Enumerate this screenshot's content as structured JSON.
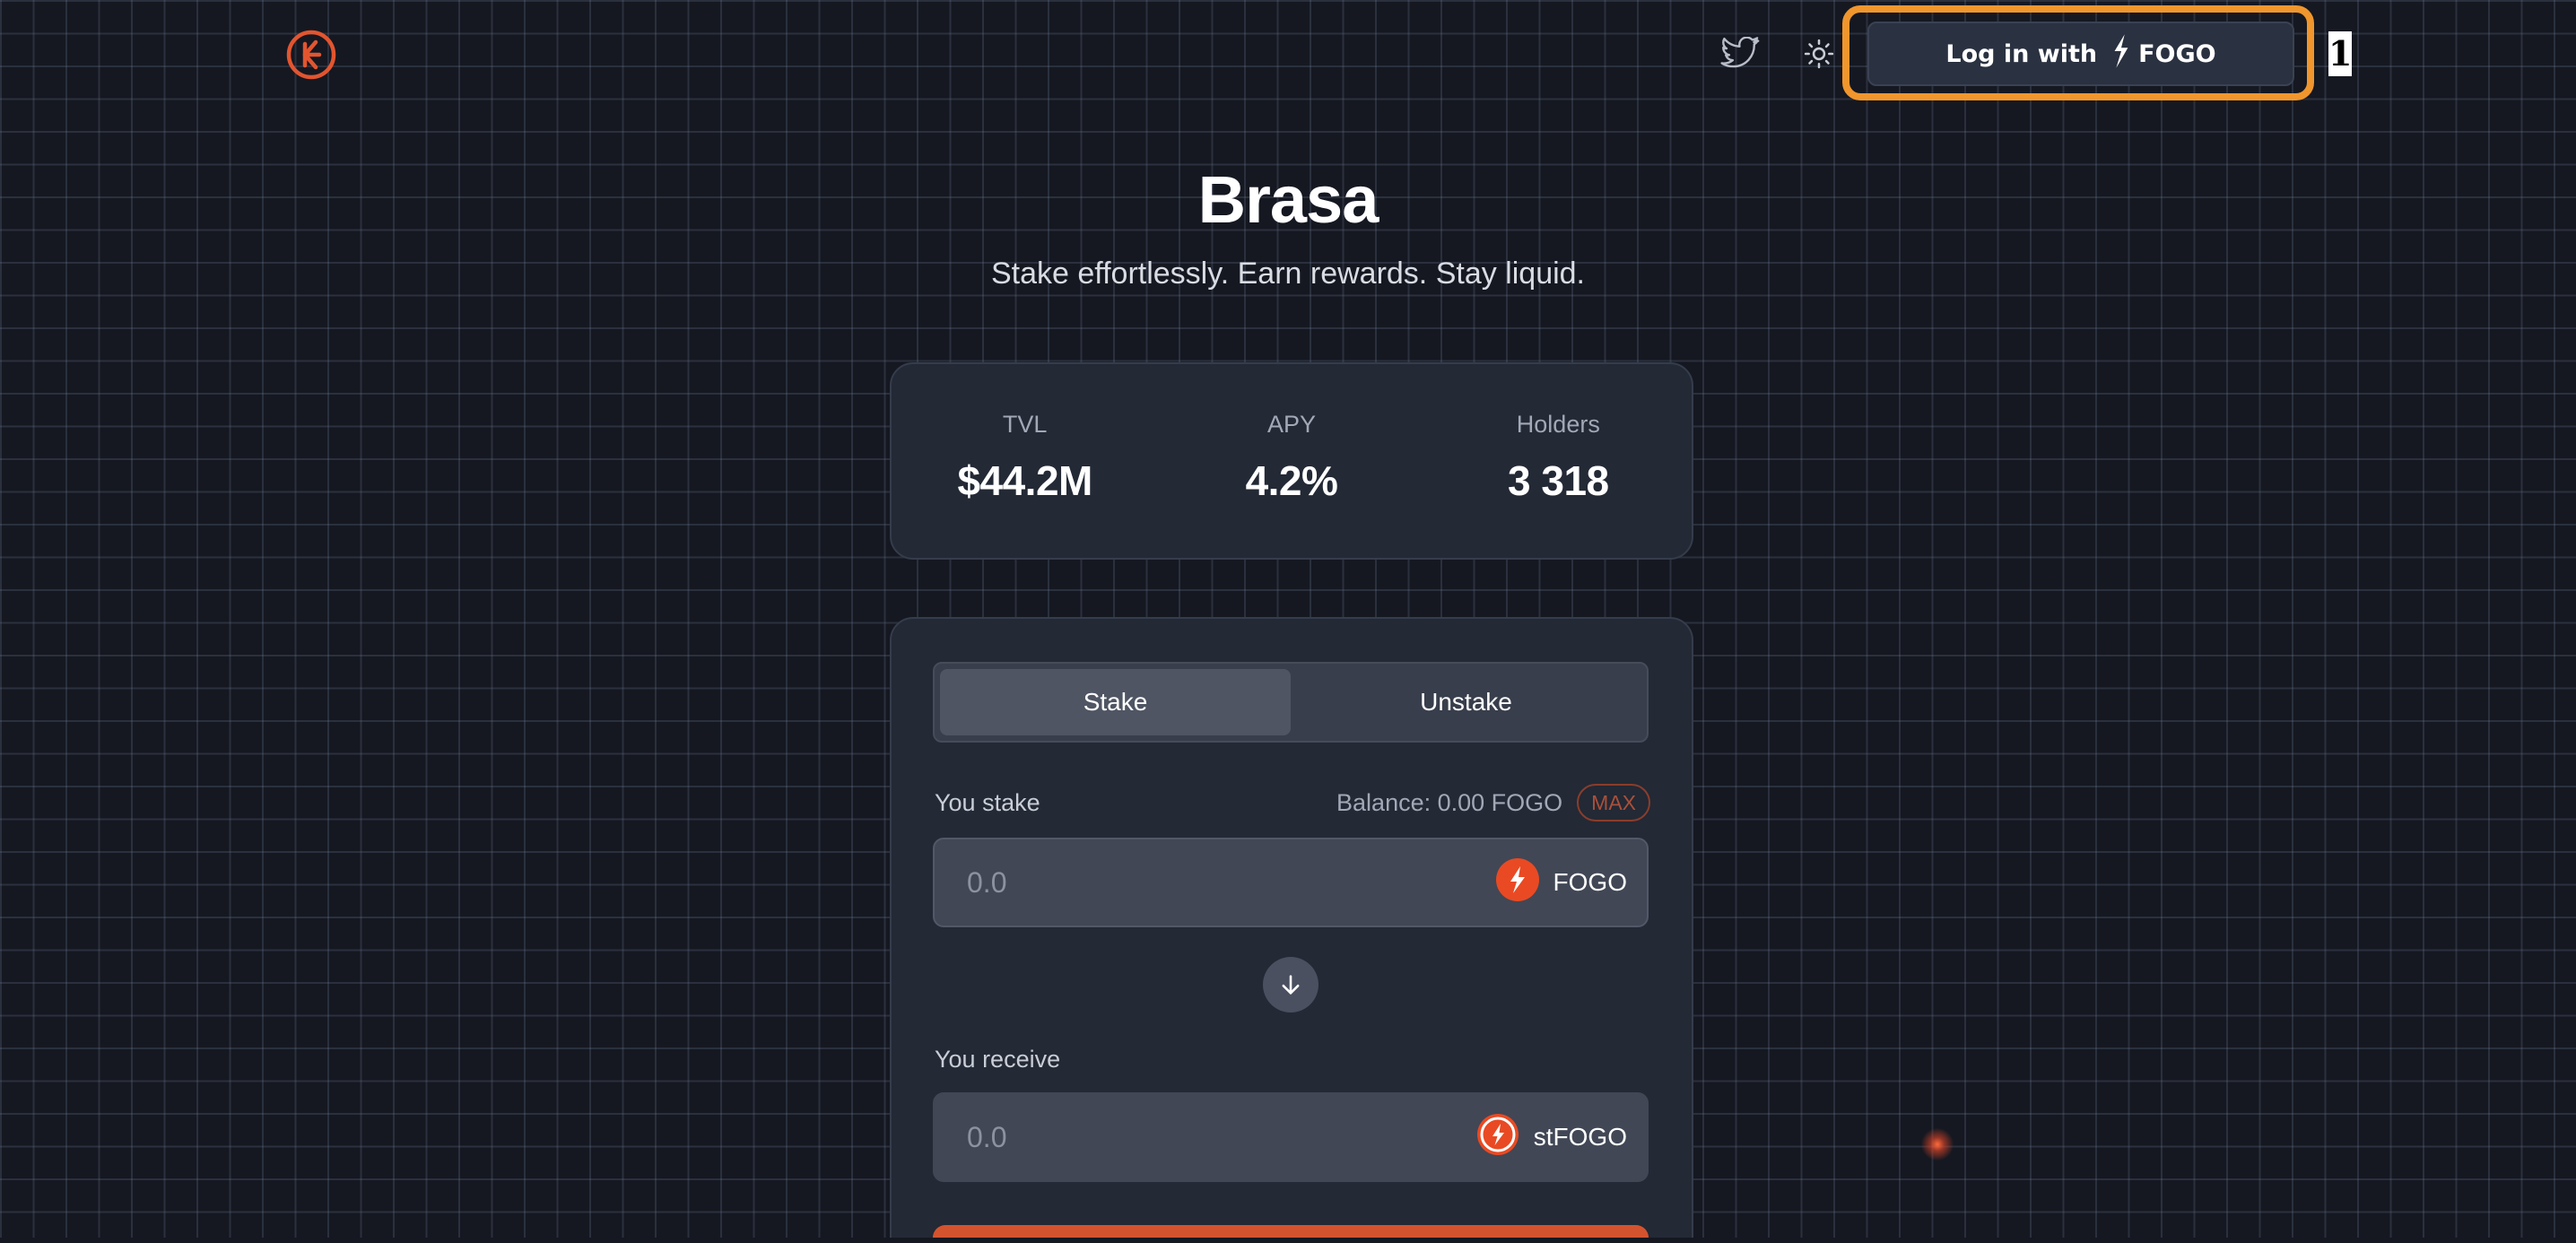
{
  "header": {
    "logo_icon": "brasa-logo-icon",
    "twitter_icon": "twitter-bird-icon",
    "theme_icon": "sun-icon",
    "login": {
      "prefix": "Log in with",
      "brand": "FOGO",
      "brand_icon": "fogo-bolt-icon"
    },
    "marker": "1"
  },
  "hero": {
    "title": "Brasa",
    "subtitle": "Stake effortlessly. Earn rewards. Stay liquid."
  },
  "stats": [
    {
      "label": "TVL",
      "value": "$44.2M"
    },
    {
      "label": "APY",
      "value": "4.2%"
    },
    {
      "label": "Holders",
      "value": "3 318"
    }
  ],
  "stake_form": {
    "tabs": [
      {
        "label": "Stake",
        "active": true
      },
      {
        "label": "Unstake",
        "active": false
      }
    ],
    "stake_label": "You stake",
    "balance": "Balance: 0.00 FOGO",
    "max_label": "MAX",
    "stake_input_placeholder": "0.0",
    "stake_token": "FOGO",
    "receive_label": "You receive",
    "receive_input_placeholder": "0.0",
    "receive_token": "stFOGO",
    "arrow_icon": "arrow-down-icon"
  },
  "colors": {
    "accent": "#d4532f",
    "highlight": "#f0962d",
    "background": "#151821",
    "card": "#232935"
  }
}
